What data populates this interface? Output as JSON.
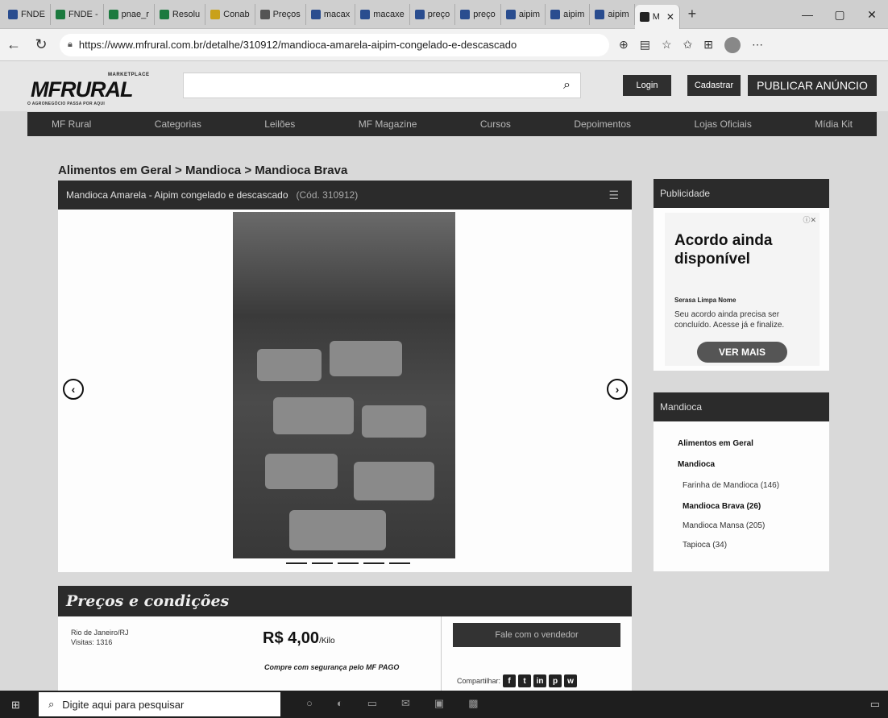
{
  "browser": {
    "tabs": [
      {
        "label": "FNDE",
        "color": "#2a4d8f"
      },
      {
        "label": "FNDE -",
        "color": "#1c7a3f"
      },
      {
        "label": "pnae_r",
        "color": "#1c7a3f"
      },
      {
        "label": "Resolu",
        "color": "#1c7a3f"
      },
      {
        "label": "Conab",
        "color": "#c9a11a"
      },
      {
        "label": "Preços",
        "color": "#555555"
      },
      {
        "label": "macax",
        "color": "#2a4d8f"
      },
      {
        "label": "macaxe",
        "color": "#2a4d8f"
      },
      {
        "label": "preço",
        "color": "#2a4d8f"
      },
      {
        "label": "preço",
        "color": "#2a4d8f"
      },
      {
        "label": "aipim",
        "color": "#2a4d8f"
      },
      {
        "label": "aipim",
        "color": "#2a4d8f"
      },
      {
        "label": "aipim",
        "color": "#2a4d8f"
      },
      {
        "label": "M",
        "color": "#222222"
      }
    ],
    "url": "https://www.mfrural.com.br/detalhe/310912/mandioca-amarela-aipim-congelado-e-descascado"
  },
  "site": {
    "logo_market": "MARKETPLACE",
    "logo_name": "MFRURAL",
    "logo_tagline": "O AGRONEGÓCIO PASSA POR AQUI",
    "login": "Login",
    "cadastrar": "Cadastrar",
    "publicar": "PUBLICAR ANÚNCIO",
    "nav": [
      "MF Rural",
      "Categorias",
      "Leilões",
      "MF Magazine",
      "Cursos",
      "Depoimentos",
      "Lojas Oficiais",
      "Mídia Kit"
    ]
  },
  "breadcrumb": "Alimentos em Geral > Mandioca > Mandioca Brava",
  "product": {
    "title": "Mandioca Amarela - Aipim congelado e descascado",
    "code": "(Cód. 310912)"
  },
  "sidebar": {
    "ad_heading": "Publicidade",
    "ad_title": "Acordo ainda disponível",
    "ad_brand": "Serasa Limpa Nome",
    "ad_text": "Seu acordo ainda precisa ser concluído. Acesse já e finalize.",
    "ad_button": "VER MAIS",
    "cat_heading": "Mandioca",
    "cat_root": "Alimentos em Geral",
    "cat_parent": "Mandioca",
    "cat_items": [
      {
        "label": "Farinha de Mandioca (146)",
        "bold": false
      },
      {
        "label": "Mandioca Brava (26)",
        "bold": true
      },
      {
        "label": "Mandioca Mansa (205)",
        "bold": false
      },
      {
        "label": "Tapioca (34)",
        "bold": false
      }
    ]
  },
  "prices": {
    "heading": "Preços e condições",
    "location": "Rio de Janeiro/RJ",
    "visits": "Visitas: 1316",
    "price": "R$ 4,00",
    "unit": "/Kilo",
    "safe": "Compre com segurança pelo MF PAGO",
    "contact": "Fale com o vendedor",
    "share": "Compartilhar:"
  },
  "taskbar": {
    "search_placeholder": "Digite aqui para pesquisar"
  }
}
